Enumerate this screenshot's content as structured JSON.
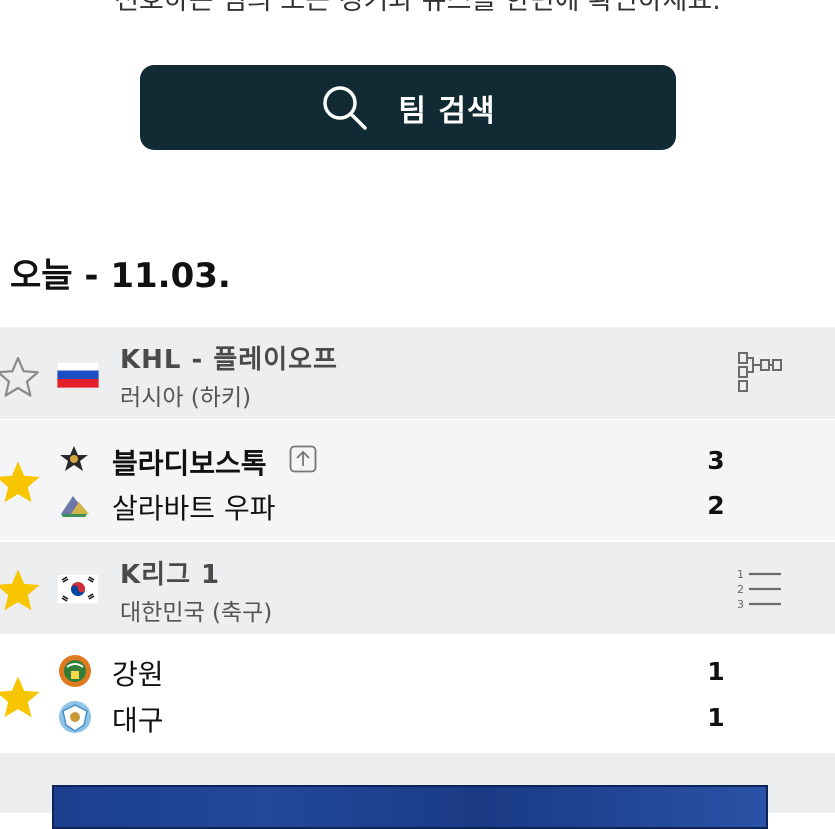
{
  "intro": {
    "text": "선호하는 팀의 모든 경기와 뉴스를 한번에 확인하세요."
  },
  "search": {
    "label": "팀 검색"
  },
  "date_header": "오늘 - 11.03.",
  "leagues": [
    {
      "name": "KHL - 플레이오프",
      "country": "러시아 (하키)",
      "favorite": false,
      "flag": "russia-flag",
      "tool": "bracket-icon",
      "match": {
        "favorite": true,
        "home": {
          "name": "블라디보스톡",
          "score": "3",
          "winner": true
        },
        "away": {
          "name": "살라바트 우파",
          "score": "2",
          "winner": false
        }
      }
    },
    {
      "name": "K리그 1",
      "country": "대한민국 (축구)",
      "favorite": true,
      "flag": "south-korea-flag",
      "tool": "standings-icon",
      "match": {
        "favorite": true,
        "home": {
          "name": "강원",
          "score": "1",
          "winner": false
        },
        "away": {
          "name": "대구",
          "score": "1",
          "winner": false
        }
      }
    }
  ],
  "colors": {
    "search_bg": "#122a33",
    "star": "#f7c600",
    "league_bg": "#eceeef"
  }
}
